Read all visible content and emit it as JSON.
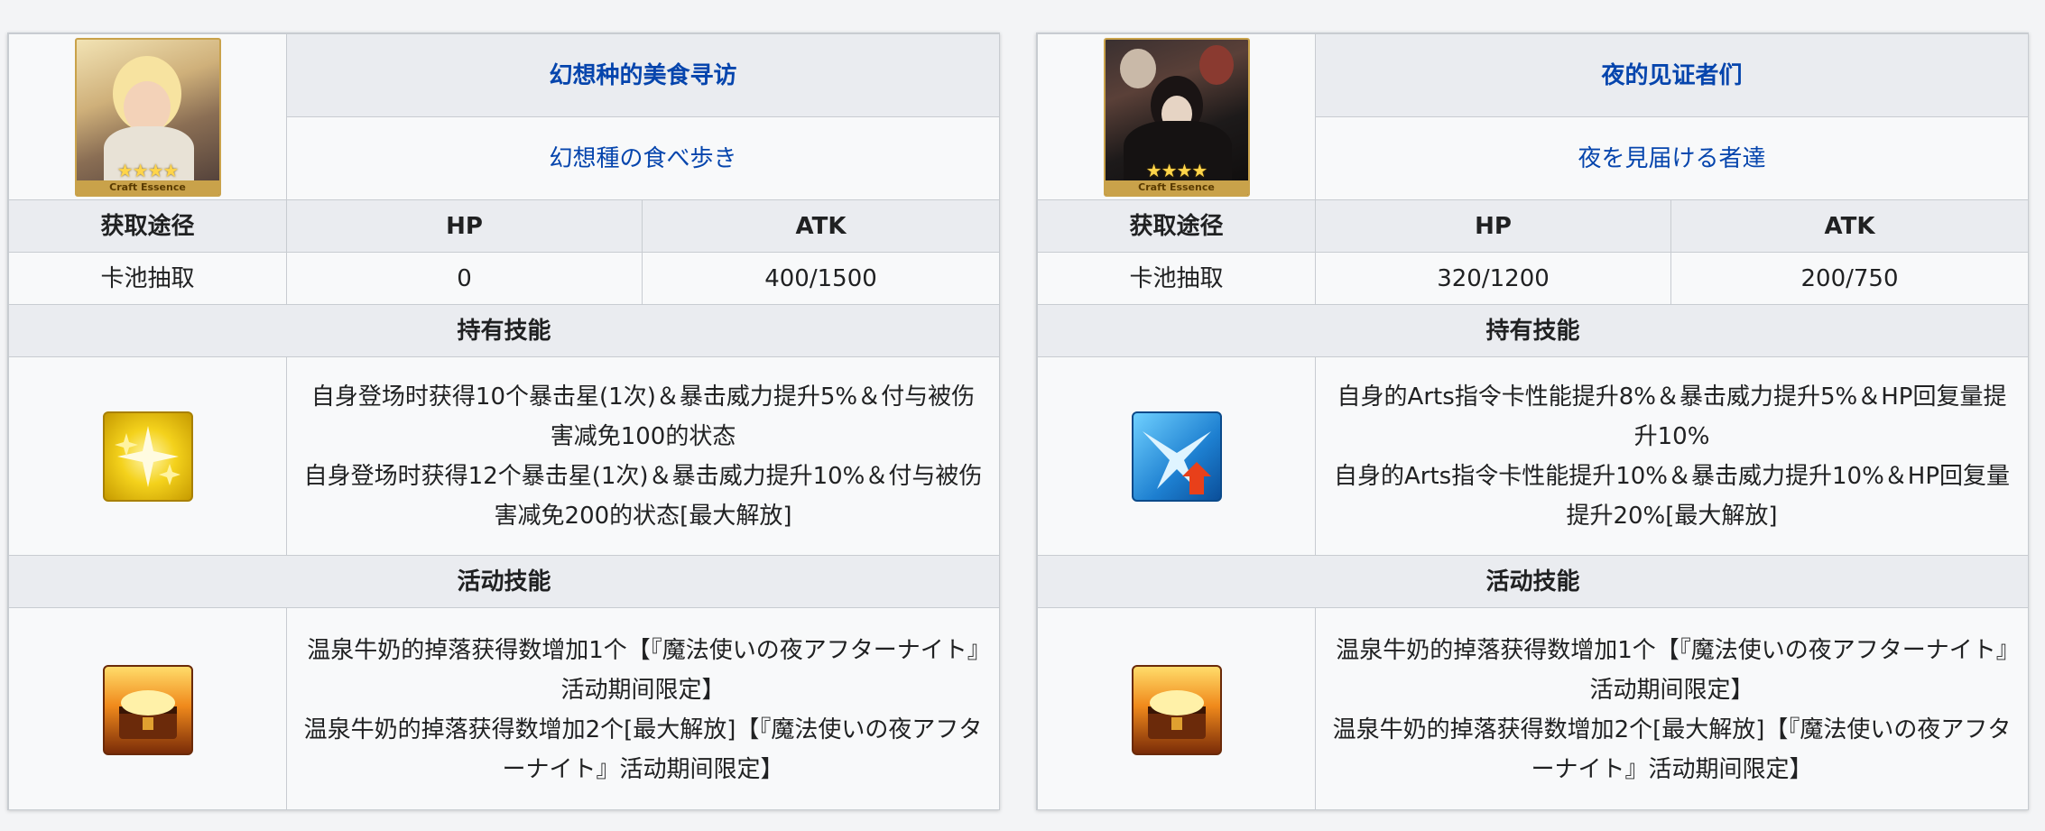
{
  "cards": [
    {
      "name_cn": "幻想种的美食寻访",
      "name_jp": "幻想種の食べ歩き",
      "portrait": {
        "stars": "★★★★",
        "label": "Craft Essence"
      },
      "headers": {
        "source": "获取途径",
        "hp": "HP",
        "atk": "ATK"
      },
      "stats": {
        "source": "卡池抽取",
        "hp": "0",
        "atk": "400/1500"
      },
      "held_skill_title": "持有技能",
      "held_skill_icon": "critical-star-icon",
      "held_skill_lines": [
        "自身登场时获得10个暴击星(1次)＆暴击威力提升5%＆付与被伤害减免100的状态",
        "自身登场时获得12个暴击星(1次)＆暴击威力提升10%＆付与被伤害减免200的状态[最大解放]"
      ],
      "event_skill_title": "活动技能",
      "event_skill_icon": "treasure-chest-icon",
      "event_skill_lines": [
        "温泉牛奶的掉落获得数增加1个【『魔法使いの夜アフターナイト』活动期间限定】",
        "温泉牛奶的掉落获得数增加2个[最大解放]【『魔法使いの夜アフターナイト』活动期间限定】"
      ]
    },
    {
      "name_cn": "夜的见证者们",
      "name_jp": "夜を見届ける者達",
      "portrait": {
        "stars": "★★★★",
        "label": "Craft Essence"
      },
      "headers": {
        "source": "获取途径",
        "hp": "HP",
        "atk": "ATK"
      },
      "stats": {
        "source": "卡池抽取",
        "hp": "320/1200",
        "atk": "200/750"
      },
      "held_skill_title": "持有技能",
      "held_skill_icon": "arts-up-icon",
      "held_skill_lines": [
        "自身的Arts指令卡性能提升8%＆暴击威力提升5%＆HP回复量提升10%",
        "自身的Arts指令卡性能提升10%＆暴击威力提升10%＆HP回复量提升20%[最大解放]"
      ],
      "event_skill_title": "活动技能",
      "event_skill_icon": "treasure-chest-icon",
      "event_skill_lines": [
        "温泉牛奶的掉落获得数增加1个【『魔法使いの夜アフターナイト』活动期间限定】",
        "温泉牛奶的掉落获得数增加2个[最大解放]【『魔法使いの夜アフターナイト』活动期间限定】"
      ]
    }
  ],
  "colors": {
    "link": "#0645ad",
    "header_bg": "#eaecf0",
    "border": "#c8ccd1",
    "cell_bg": "#f8f9fa",
    "page_bg": "#f3f4f6"
  }
}
